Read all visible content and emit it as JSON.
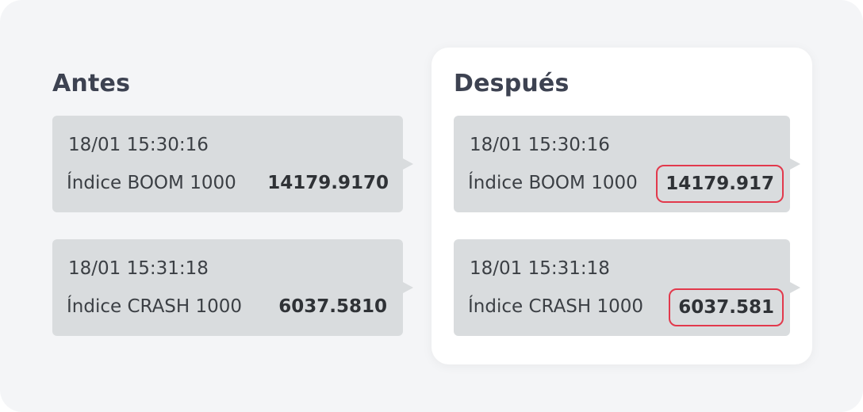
{
  "before": {
    "title": "Antes",
    "messages": [
      {
        "timestamp": "18/01 15:30:16",
        "instrument": "Índice BOOM 1000",
        "value": "14179.9170"
      },
      {
        "timestamp": "18/01 15:31:18",
        "instrument": "Índice CRASH 1000",
        "value": "6037.5810"
      }
    ]
  },
  "after": {
    "title": "Después",
    "messages": [
      {
        "timestamp": "18/01 15:30:16",
        "instrument": "Índice BOOM 1000",
        "value": "14179.917"
      },
      {
        "timestamp": "18/01 15:31:18",
        "instrument": "Índice CRASH 1000",
        "value": "6037.581"
      }
    ]
  },
  "colors": {
    "highlight": "#e2394c",
    "bubble": "#d9dcde",
    "background": "#f4f5f7"
  }
}
